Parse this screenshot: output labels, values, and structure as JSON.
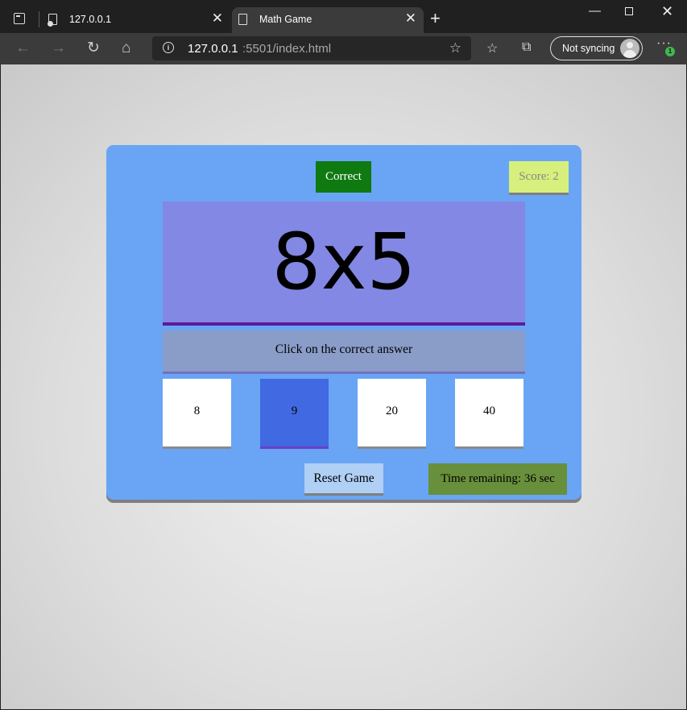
{
  "browser": {
    "tabs": [
      {
        "label": "127.0.0.1",
        "active": false
      },
      {
        "label": "Math Game",
        "active": true
      }
    ],
    "address": {
      "host": "127.0.0.1",
      "path": ":5501/index.html"
    },
    "sync_label": "Not syncing",
    "notification_badge": "1"
  },
  "game": {
    "status": "Correct",
    "score_label": "Score: 2",
    "question": "8x5",
    "instruction": "Click on the correct answer",
    "choices": [
      "8",
      "9",
      "20",
      "40"
    ],
    "selected_choice_index": 1,
    "reset_label": "Reset Game",
    "timer_label": "Time remaining: 36 sec"
  },
  "colors": {
    "panel": "#69a5f4",
    "correct_bg": "#0e7a11",
    "score_bg": "#d7ef7c",
    "question_bg": "#8388e4",
    "selected_choice_bg": "#4169e1",
    "timer_bg": "#688f3b"
  }
}
